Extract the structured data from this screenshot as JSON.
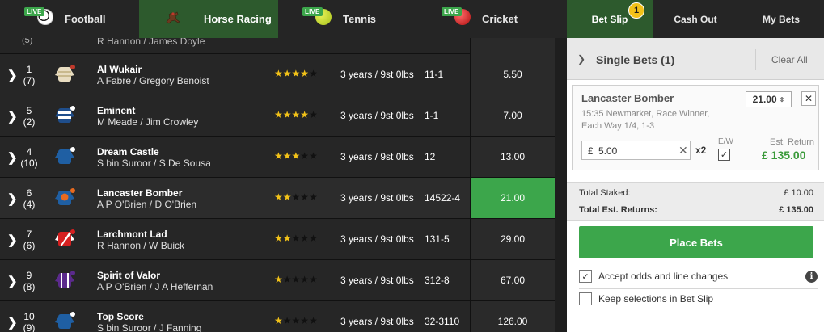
{
  "nav": {
    "sports": [
      {
        "label": "Football",
        "live": "LIVE",
        "icon": "football-icon"
      },
      {
        "label": "Horse Racing",
        "live": "",
        "icon": "horse-racing-icon"
      },
      {
        "label": "Tennis",
        "live": "LIVE",
        "icon": "tennis-ball-icon"
      },
      {
        "label": "Cricket",
        "live": "LIVE",
        "icon": "cricket-ball-icon"
      }
    ],
    "tabs": {
      "betslip": "Bet Slip",
      "betslip_count": "1",
      "cashout": "Cash Out",
      "mybets": "My Bets"
    },
    "active_sport": "Horse Racing",
    "colors": {
      "active_bg": "#2d5a2d",
      "live_badge": "#3ca64b",
      "count_badge": "#f2c218"
    }
  },
  "runners": {
    "partial_top": {
      "draw": "(5)",
      "jockey_trainer": "R Hannon / James Doyle"
    },
    "rows": [
      {
        "num": "1",
        "draw": "(7)",
        "name": "Al Wukair",
        "jockey_trainer": "A Fabre / Gregory Benoist",
        "stars": 4,
        "age_weight": "3 years / 9st 0lbs",
        "form": "11-1",
        "odds": "5.50",
        "selected": false
      },
      {
        "num": "5",
        "draw": "(2)",
        "name": "Eminent",
        "jockey_trainer": "M Meade / Jim Crowley",
        "stars": 4,
        "age_weight": "3 years / 9st 0lbs",
        "form": "1-1",
        "odds": "7.00",
        "selected": false
      },
      {
        "num": "4",
        "draw": "(10)",
        "name": "Dream Castle",
        "jockey_trainer": "S bin Suroor / S De Sousa",
        "stars": 3,
        "age_weight": "3 years / 9st 0lbs",
        "form": "12",
        "odds": "13.00",
        "selected": false
      },
      {
        "num": "6",
        "draw": "(4)",
        "name": "Lancaster Bomber",
        "jockey_trainer": "A P O'Brien / D O'Brien",
        "stars": 2,
        "age_weight": "3 years / 9st 0lbs",
        "form": "14522-4",
        "odds": "21.00",
        "selected": true
      },
      {
        "num": "7",
        "draw": "(6)",
        "name": "Larchmont Lad",
        "jockey_trainer": "R Hannon / W Buick",
        "stars": 2,
        "age_weight": "3 years / 9st 0lbs",
        "form": "131-5",
        "odds": "29.00",
        "selected": false
      },
      {
        "num": "9",
        "draw": "(8)",
        "name": "Spirit of Valor",
        "jockey_trainer": "A P O'Brien / J A Heffernan",
        "stars": 1,
        "age_weight": "3 years / 9st 0lbs",
        "form": "312-8",
        "odds": "67.00",
        "selected": false
      },
      {
        "num": "10",
        "draw": "(9)",
        "name": "Top Score",
        "jockey_trainer": "S bin Suroor / J Fanning",
        "stars": 1,
        "age_weight": "3 years / 9st 0lbs",
        "form": "32-3110",
        "odds": "126.00",
        "selected": false
      }
    ],
    "max_stars": 5,
    "colors": {
      "selected_odds": "#3ca64b",
      "star": "#f2c218"
    }
  },
  "betslip": {
    "header": {
      "title": "Single Bets (1)",
      "clear": "Clear All"
    },
    "bet": {
      "selection": "Lancaster Bomber",
      "race_line1": "15:35 Newmarket, Race Winner,",
      "race_line2": "Each Way 1/4, 1-3",
      "odds": "21.00",
      "currency": "£",
      "stake": "5.00",
      "multiplier": "x2",
      "ew_label": "E/W",
      "ew_checked": true,
      "est_return_label": "Est. Return",
      "est_return": "£ 135.00"
    },
    "totals": {
      "staked_label": "Total Staked:",
      "staked_value": "£ 10.00",
      "returns_label": "Total Est. Returns:",
      "returns_value": "£ 135.00"
    },
    "place_button": "Place Bets",
    "options": [
      {
        "label": "Accept odds and line changes",
        "checked": true
      },
      {
        "label": "Keep selections in Bet Slip",
        "checked": false
      }
    ],
    "colors": {
      "place_button": "#3ca64b",
      "est_return": "#3a9a3a"
    }
  }
}
